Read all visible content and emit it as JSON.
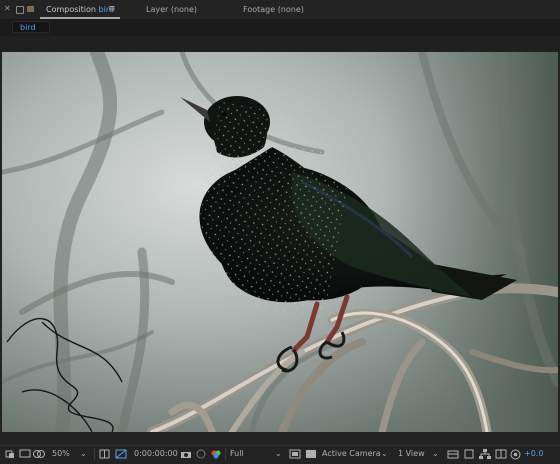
{
  "tabs": {
    "active": {
      "label": "Composition",
      "name": "bird"
    },
    "layer": "Layer (none)",
    "footage": "Footage (none)"
  },
  "breadcrumb": "bird",
  "bottom_bar": {
    "zoom": "50%",
    "timecode": "0:00:00:00",
    "resolution": "Full",
    "camera": "Active Camera",
    "views": "1 View",
    "exposure": "+0.0"
  },
  "colors": {
    "accent_blue": "#5aa0e8",
    "panel_bg": "#232323",
    "tab_bg": "#232323"
  },
  "icons": [
    "close-icon",
    "lock-icon",
    "composition-icon",
    "panel-menu-icon",
    "region-icon",
    "safe-zones-icon",
    "mask-icon",
    "dropdown-icon",
    "fit-icon",
    "transparency-grid-icon",
    "snapshot-icon",
    "show-snapshot-icon",
    "color-channels-icon",
    "toggle-view-icon",
    "reset-exposure-icon"
  ]
}
